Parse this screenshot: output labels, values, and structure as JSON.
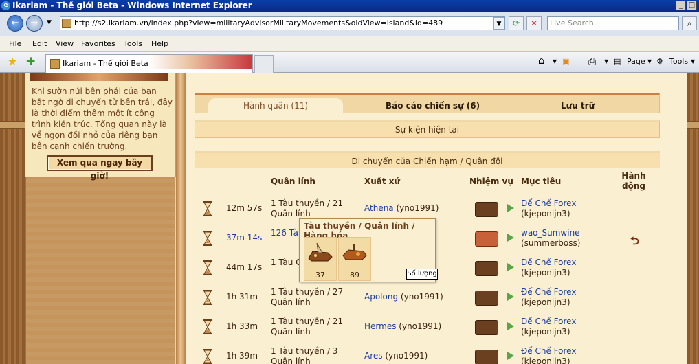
{
  "window": {
    "title": "Ikariam - Thế giới Beta - Windows Internet Explorer"
  },
  "browser": {
    "url": "http://s2.ikariam.vn/index.php?view=militaryAdvisorMilitaryMovements&oldView=island&id=489",
    "search_placeholder": "Live Search",
    "menu": [
      "File",
      "Edit",
      "View",
      "Favorites",
      "Tools",
      "Help"
    ],
    "tab_title": "Ikariam - Thế giới Beta",
    "toolbar": {
      "page": "Page",
      "tools": "Tools"
    }
  },
  "sidebar": {
    "ad_text": "Khi sườn núi bên phải của bạn bất ngờ di chuyển từ bên trái, đây là thời điểm thêm một ít công trình kiến trúc. Tổng quan này là về ngọn đồi nhỏ của riêng bạn bên cạnh chiến trường.",
    "ad_button": "Xem qua ngay bây giờ!"
  },
  "tabs": [
    {
      "label": "Hành quân (11)",
      "active": true
    },
    {
      "label": "Báo cáo chiến sự (6)",
      "active": false
    },
    {
      "label": "Lưu trữ",
      "active": false
    }
  ],
  "current_events": "Sự kiện hiện tại",
  "movements": {
    "title": "Di chuyển của Chiến hạm / Quân đội",
    "headers": {
      "units": "Quân lính",
      "origin": "Xuất xứ",
      "mission": "Nhiệm vụ",
      "target": "Mục tiêu",
      "action": "Hành động"
    },
    "rows": [
      {
        "time": "12m 57s",
        "units": "1 Tàu thuyền / 21 Quân lính",
        "origin_city": "Athena",
        "origin_player": "(yno1991)",
        "mission": "transport",
        "target_city": "Đế Chế Forex",
        "target_player": "(kjeponljn3)"
      },
      {
        "time": "37m 14s",
        "units": "126 Tàu",
        "origin_city": "",
        "origin_player": "",
        "mission": "attack",
        "target_city": "wao_Sumwine",
        "target_player": "(summerboss)",
        "has_action": true
      },
      {
        "time": "44m 17s",
        "units": "1 Tàu Quân lính",
        "origin_city": "",
        "origin_player": "",
        "mission": "transport",
        "target_city": "Đế Chế Forex",
        "target_player": "(kjeponljn3)"
      },
      {
        "time": "1h 31m",
        "units": "1 Tàu thuyền / 27 Quân lính",
        "origin_city": "Apolong",
        "origin_player": "(yno1991)",
        "mission": "transport",
        "target_city": "Đế Chế Forex",
        "target_player": "(kjeponljn3)"
      },
      {
        "time": "1h 33m",
        "units": "1 Tàu thuyền / 21 Quân lính",
        "origin_city": "Hermes",
        "origin_player": "(yno1991)",
        "mission": "transport",
        "target_city": "Đế Chế Forex",
        "target_player": "(kjeponljn3)"
      },
      {
        "time": "1h 39m",
        "units": "1 Tàu thuyền / 3 Quân lính",
        "origin_city": "Ares",
        "origin_player": "(yno1991)",
        "mission": "transport",
        "target_city": "Đế Chế Forex",
        "target_player": "(kjeponljn3)"
      }
    ]
  },
  "popup": {
    "title": "Tàu thuyền / Quân lính / Hàng hóa",
    "slots": [
      {
        "count": "37"
      },
      {
        "count": "89"
      }
    ],
    "tooltip": "Số lượng"
  }
}
